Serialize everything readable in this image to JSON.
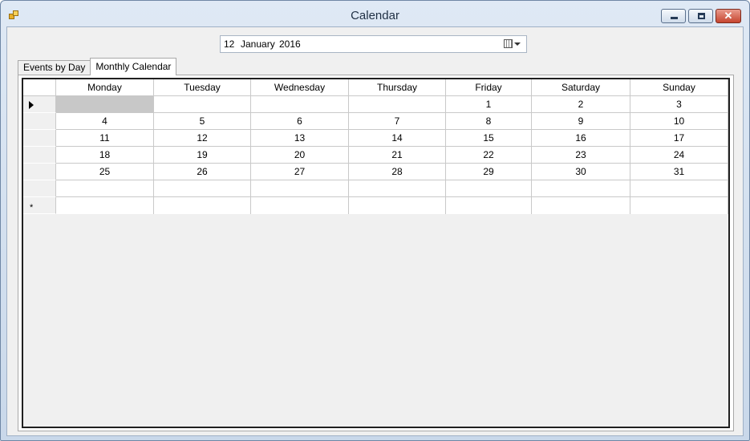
{
  "window": {
    "title": "Calendar"
  },
  "date_picker": {
    "day": "12",
    "month": "January",
    "year": "2016"
  },
  "tabs": [
    {
      "label": "Events by Day",
      "active": false
    },
    {
      "label": "Monthly Calendar",
      "active": true
    }
  ],
  "grid": {
    "columns": [
      "Monday",
      "Tuesday",
      "Wednesday",
      "Thursday",
      "Friday",
      "Saturday",
      "Sunday"
    ],
    "rows": [
      [
        "",
        "",
        "",
        "",
        "1",
        "2",
        "3"
      ],
      [
        "4",
        "5",
        "6",
        "7",
        "8",
        "9",
        "10"
      ],
      [
        "11",
        "12",
        "13",
        "14",
        "15",
        "16",
        "17"
      ],
      [
        "18",
        "19",
        "20",
        "21",
        "22",
        "23",
        "24"
      ],
      [
        "25",
        "26",
        "27",
        "28",
        "29",
        "30",
        "31"
      ],
      [
        "",
        "",
        "",
        "",
        "",
        "",
        ""
      ]
    ],
    "new_row_marker": "*"
  },
  "icons": {
    "app": "app-icon",
    "minimize": "minimize-icon",
    "maximize": "maximize-icon",
    "close": "close-icon",
    "calendar_dropdown": "calendar-dropdown-icon",
    "current_row": "current-row-arrow-icon"
  }
}
